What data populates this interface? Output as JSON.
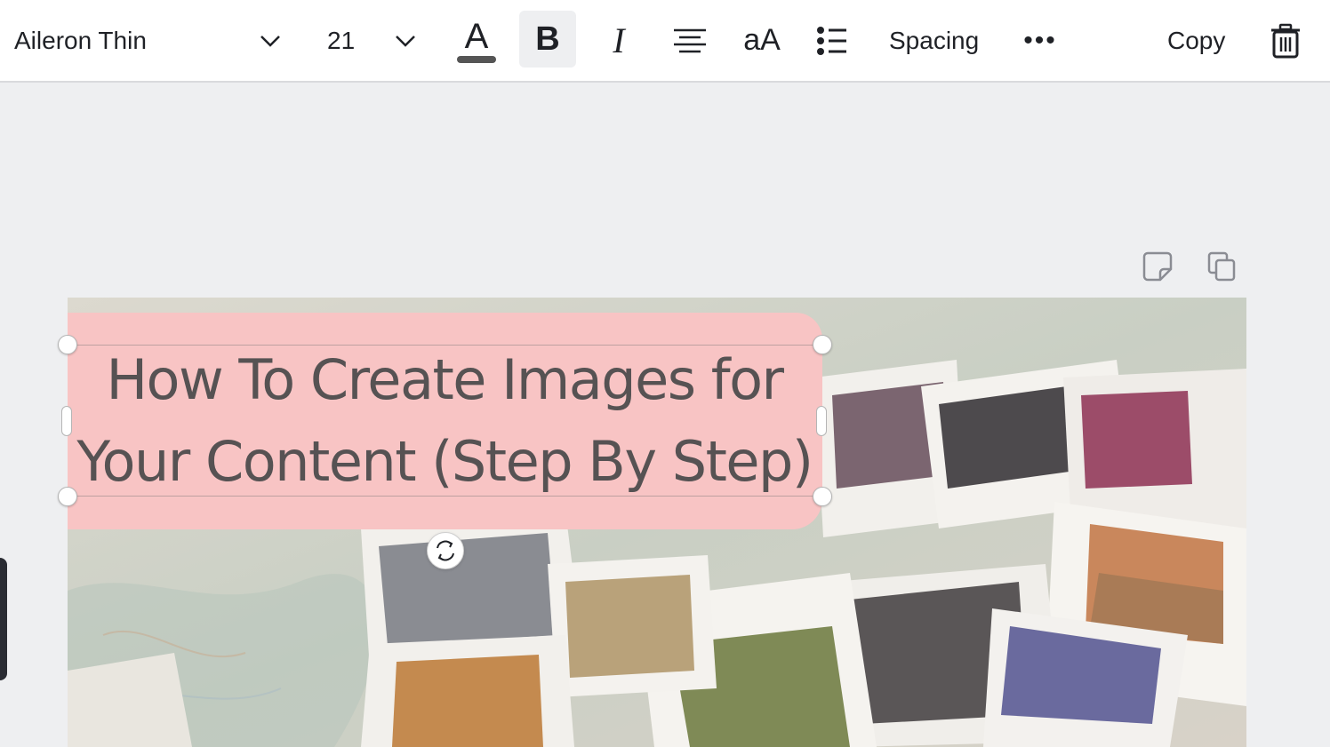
{
  "toolbar": {
    "font_name": "Aileron Thin",
    "font_size": "21",
    "text_color_letter": "A",
    "text_color": "#555555",
    "bold_label": "B",
    "italic_label": "I",
    "case_label": "aA",
    "spacing_label": "Spacing",
    "more_label": "•••",
    "copy_label": "Copy"
  },
  "icons": {
    "font_dropdown": "chevron-down-icon",
    "size_dropdown": "chevron-down-icon",
    "align": "align-center-icon",
    "list": "bulleted-list-icon",
    "delete": "trash-icon",
    "page_note": "note-icon",
    "page_duplicate": "duplicate-icon",
    "rotate": "rotate-icon"
  },
  "design": {
    "headline_line1": "How To Create Images for",
    "headline_line2": "Your Content (Step By Step)",
    "text_box_color": "#f8c4c4"
  }
}
